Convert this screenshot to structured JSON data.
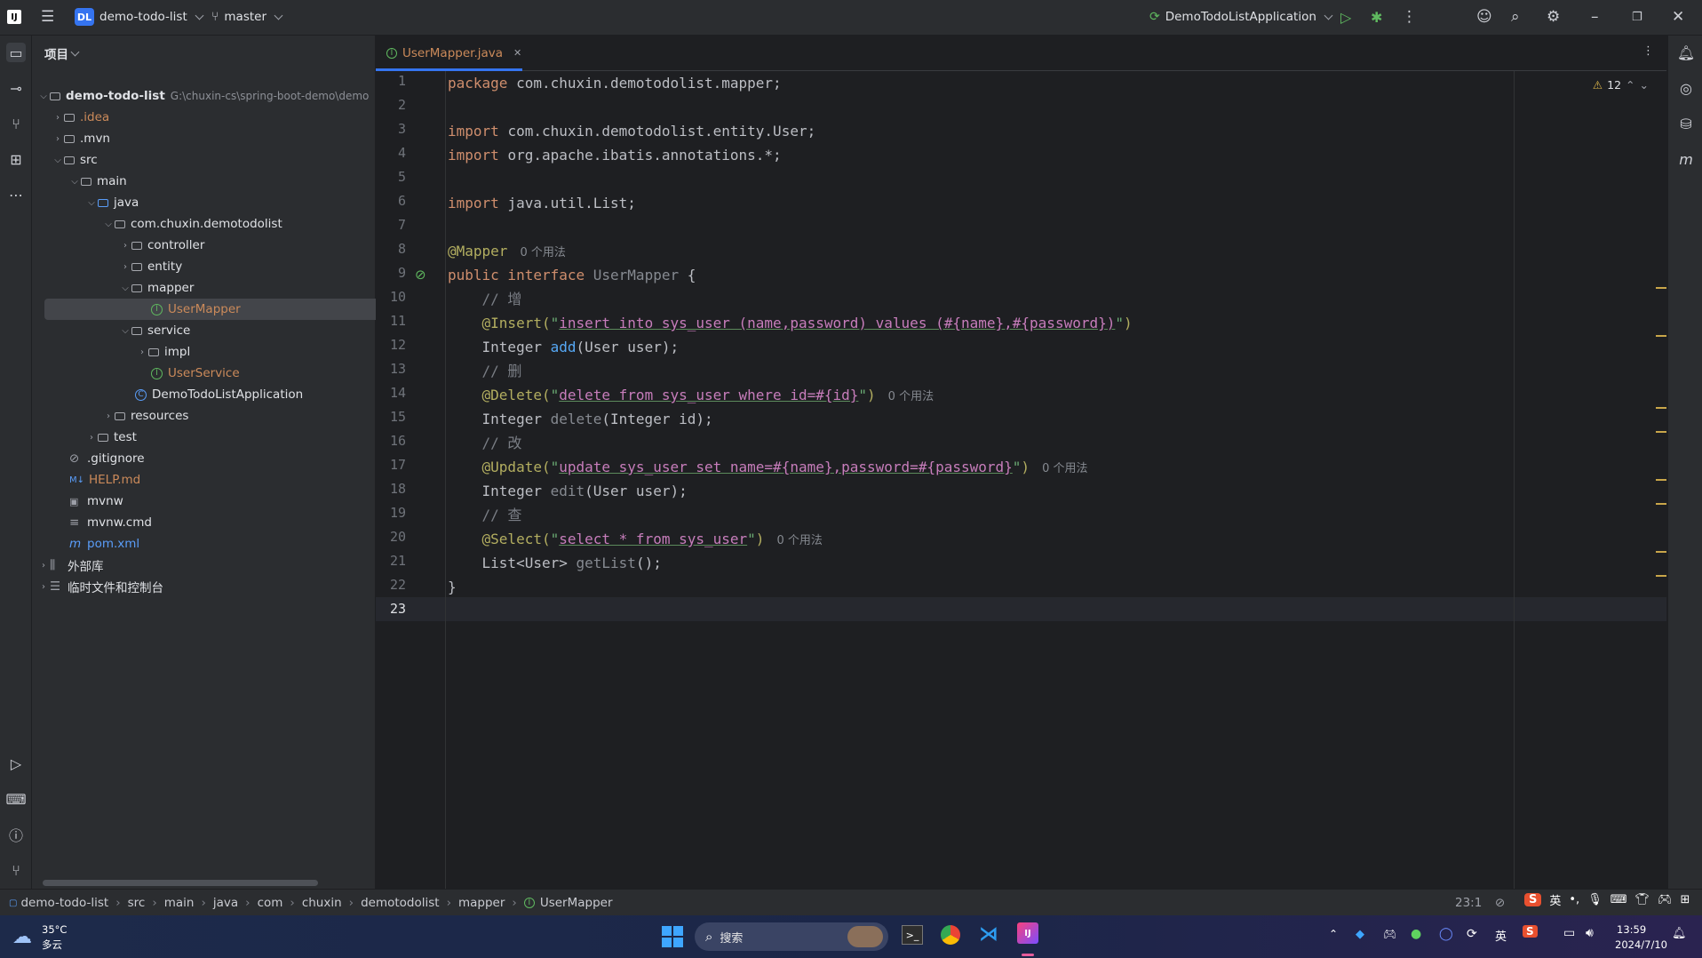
{
  "topbar": {
    "project_badge": "DL",
    "project_name": "demo-todo-list",
    "branch": "master",
    "run_config": "DemoTodoListApplication"
  },
  "project_panel": {
    "title": "项目",
    "root_name": "demo-todo-list",
    "root_path": "G:\\chuxin-cs\\spring-boot-demo\\demo",
    "items": [
      {
        "label": ".idea"
      },
      {
        "label": ".mvn"
      },
      {
        "label": "src"
      },
      {
        "label": "main"
      },
      {
        "label": "java"
      },
      {
        "label": "com.chuxin.demotodolist"
      },
      {
        "label": "controller"
      },
      {
        "label": "entity"
      },
      {
        "label": "mapper"
      },
      {
        "label": "UserMapper"
      },
      {
        "label": "service"
      },
      {
        "label": "impl"
      },
      {
        "label": "UserService"
      },
      {
        "label": "DemoTodoListApplication"
      },
      {
        "label": "resources"
      },
      {
        "label": "test"
      },
      {
        "label": ".gitignore"
      },
      {
        "label": "HELP.md"
      },
      {
        "label": "mvnw"
      },
      {
        "label": "mvnw.cmd"
      },
      {
        "label": "pom.xml"
      },
      {
        "label": "外部库"
      },
      {
        "label": "临时文件和控制台"
      }
    ]
  },
  "editor": {
    "tab_label": "UserMapper.java",
    "warning_count": "12",
    "usage_hint": "0 个用法",
    "lines": [
      "1",
      "2",
      "3",
      "4",
      "5",
      "6",
      "7",
      "8",
      "9",
      "10",
      "11",
      "12",
      "13",
      "14",
      "15",
      "16",
      "17",
      "18",
      "19",
      "20",
      "21",
      "22",
      "23"
    ],
    "code": {
      "l1a": "package ",
      "l1b": "com.chuxin.demotodolist.mapper;",
      "l3a": "import ",
      "l3b": "com.chuxin.demotodolist.entity.User;",
      "l4a": "import ",
      "l4b": "org.apache.ibatis.annotations.*;",
      "l6a": "import ",
      "l6b": "java.util.List;",
      "l8a": "@Mapper",
      "l9a": "public interface ",
      "l9b": "UserMapper",
      "l9c": " {",
      "l10": "    // 增",
      "l11a": "    @Insert(",
      "l11b": "\"",
      "l11c": "insert into sys_user (name,password) values (#{name},#{password})",
      "l11d": "\"",
      "l11e": ")",
      "l12a": "    Integer ",
      "l12b": "add",
      "l12c": "(User user);",
      "l13": "    // 删",
      "l14a": "    @Delete(",
      "l14b": "\"",
      "l14c": "delete from sys_user where id=#{id}",
      "l14d": "\"",
      "l14e": ")",
      "l15a": "    Integer ",
      "l15b": "delete",
      "l15c": "(Integer id);",
      "l16": "    // 改",
      "l17a": "    @Update(",
      "l17b": "\"",
      "l17c": "update sys_user set name=#{name},password=#{password}",
      "l17d": "\"",
      "l17e": ")",
      "l18a": "    Integer ",
      "l18b": "edit",
      "l18c": "(User user);",
      "l19": "    // 查",
      "l20a": "    @Select(",
      "l20b": "\"",
      "l20c": "select * from sys_user",
      "l20d": "\"",
      "l20e": ")",
      "l21a": "    List<User> ",
      "l21b": "getList",
      "l21c": "();",
      "l22": "}"
    }
  },
  "statusbar": {
    "breadcrumbs": [
      "demo-todo-list",
      "src",
      "main",
      "java",
      "com",
      "chuxin",
      "demotodolist",
      "mapper",
      "UserMapper"
    ],
    "position": "23:1"
  },
  "taskbar": {
    "temperature": "35°C",
    "weather": "多云",
    "search_placeholder": "搜索",
    "ime": "英",
    "time": "13:59",
    "date": "2024/7/10"
  },
  "colors": {
    "accent": "#3574f0",
    "keyword": "#cf8e6d",
    "annotation": "#b3ae60",
    "string": "#6aab73",
    "function": "#56a8f5",
    "file_modified": "#cb8a5a"
  }
}
